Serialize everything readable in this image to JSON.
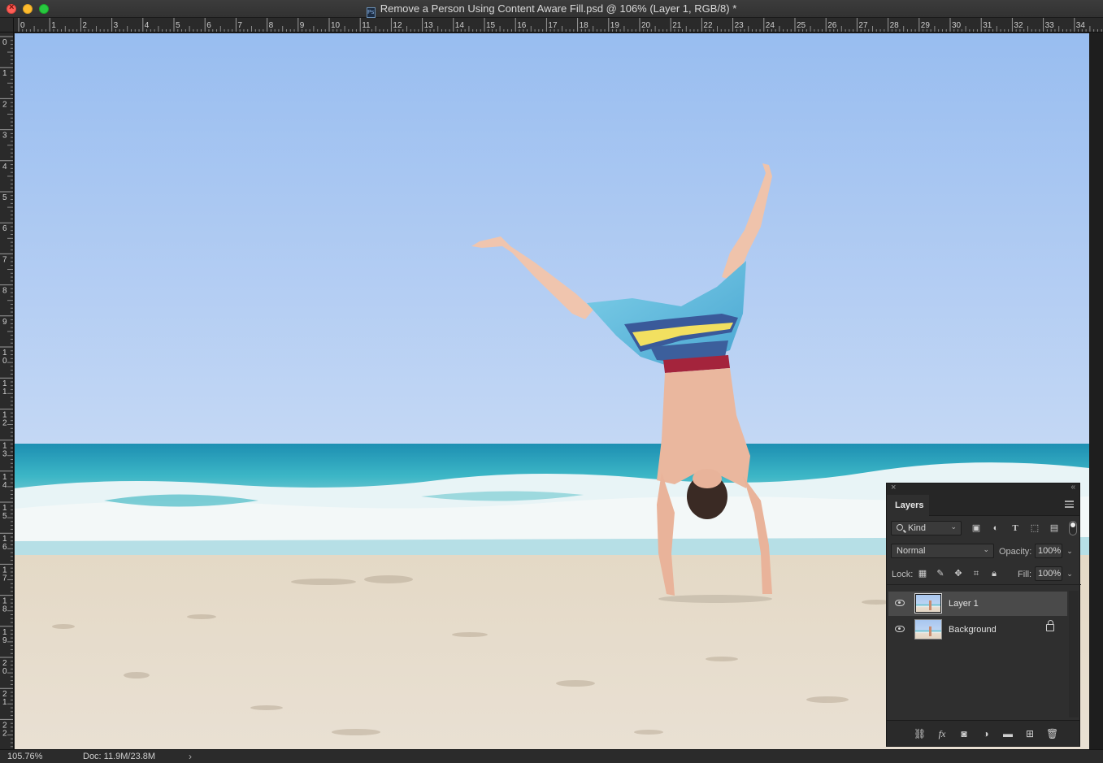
{
  "window": {
    "title": "Remove a Person Using Content Aware Fill.psd @ 106% (Layer 1, RGB/8) *",
    "file_badge": "Ps"
  },
  "rulers": {
    "top_labels": [
      "0",
      "1",
      "2",
      "3",
      "4",
      "5",
      "6",
      "7",
      "8",
      "9",
      "10",
      "11",
      "12",
      "13",
      "14",
      "15",
      "16",
      "17",
      "18",
      "19",
      "20",
      "21",
      "22",
      "23",
      "24",
      "25",
      "26",
      "27",
      "28",
      "29",
      "30",
      "31",
      "32",
      "33",
      "34"
    ],
    "left_labels": [
      "0",
      "1",
      "2",
      "3",
      "4",
      "5",
      "6",
      "7",
      "8",
      "9",
      "10",
      "11",
      "12",
      "13",
      "14",
      "15",
      "16",
      "17",
      "18",
      "19",
      "20",
      "21",
      "22"
    ]
  },
  "status": {
    "zoom": "105.76%",
    "doc": "Doc: 11.9M/23.8M",
    "arrow": "›"
  },
  "layers_panel": {
    "tab_label": "Layers",
    "filter": {
      "kind_label": "Kind",
      "icons": [
        "image-filter-icon",
        "adjustment-filter-icon",
        "type-filter-icon",
        "shape-filter-icon",
        "smart-object-filter-icon"
      ]
    },
    "blend_mode": "Normal",
    "opacity_label": "Opacity:",
    "opacity_value": "100%",
    "lock_label": "Lock:",
    "fill_label": "Fill:",
    "fill_value": "100%",
    "layers": [
      {
        "name": "Layer 1",
        "visible": true,
        "selected": true,
        "locked": false
      },
      {
        "name": "Background",
        "visible": true,
        "selected": false,
        "locked": true
      }
    ],
    "bottom_icons": [
      "link-layers-icon",
      "fx-icon",
      "add-mask-icon",
      "adjustment-layer-icon",
      "new-group-icon",
      "new-layer-icon",
      "delete-layer-icon"
    ],
    "fx_text": "fx"
  },
  "colors": {
    "sky_top": "#9fc0f0",
    "sea": "#2fa9c0",
    "sand": "#e6dccd",
    "panel_bg": "#2f2f2f"
  }
}
